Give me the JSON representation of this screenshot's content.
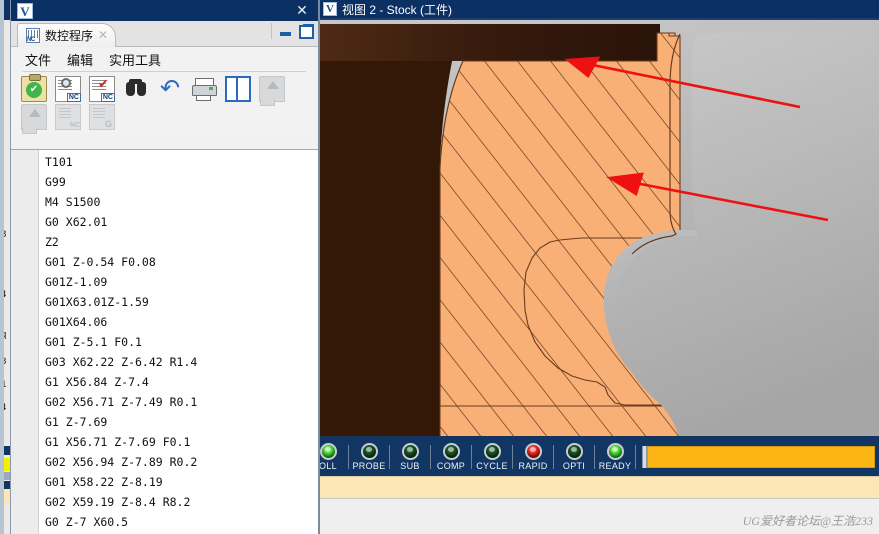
{
  "background_window": {
    "name": "hidden-background-window"
  },
  "nc_window": {
    "title_logo": "V",
    "close_label": "✕",
    "tab": {
      "label": "数控程序",
      "icon": "nc-document-icon",
      "close_label": "✕"
    },
    "window_buttons": {
      "minimize": "minimize-icon",
      "restore": "restore-icon"
    },
    "menu": [
      "文件",
      "编辑",
      "实用工具"
    ],
    "toolbar_row1": [
      {
        "name": "verify-program-icon",
        "label": "验证"
      },
      {
        "name": "nc-preview-icon",
        "label": "预览"
      },
      {
        "name": "nc-check-icon",
        "label": "检查"
      },
      {
        "name": "find-icon",
        "label": "查找"
      },
      {
        "name": "undo-icon",
        "label": "撤销"
      },
      {
        "name": "print-icon",
        "label": "打印"
      },
      {
        "name": "split-view-icon",
        "label": "分屏"
      },
      {
        "name": "upload-icon-disabled",
        "label": "上传"
      }
    ],
    "toolbar_row2": [
      {
        "name": "download-icon-disabled",
        "label": "下载"
      },
      {
        "name": "nc-file-icon-disabled",
        "label": "NC文件"
      },
      {
        "name": "g-file-icon-disabled",
        "label": "G文件"
      }
    ],
    "current_line_marker": "current-line-arrow",
    "code_lines": [
      "T101",
      "G99",
      "M4 S1500",
      "G0 X62.01",
      "Z2",
      "G01 Z-0.54 F0.08",
      "G01Z-1.09",
      "G01X63.01Z-1.59",
      "G01X64.06",
      "G01 Z-5.1 F0.1",
      "G03 X62.22 Z-6.42 R1.4",
      "G1 X56.84 Z-7.4",
      "G02 X56.71 Z-7.49 R0.1",
      "G1 Z-7.69",
      "G1 X56.71 Z-7.69 F0.1",
      "G02 X56.94 Z-7.89 R0.2",
      "G01 X58.22 Z-8.19",
      "G02 X59.19 Z-8.4 R8.2",
      "G0 Z-7 X60.5"
    ]
  },
  "view_window": {
    "title_logo": "V",
    "title": "视图 2 - Stock (工件)",
    "viewport": {
      "name": "stock-3d-viewport",
      "stock_color": "#f8b077",
      "hatch_color": "#5a2f18",
      "background_color": "#bdbdbd",
      "chuck_color": "#3b1f10",
      "annotation_arrow_color": "#ee1111",
      "annotations": 2
    },
    "status_leds": [
      {
        "label": "OLL",
        "state": "green"
      },
      {
        "label": "PROBE",
        "state": "dark"
      },
      {
        "label": "SUB",
        "state": "dark"
      },
      {
        "label": "COMP",
        "state": "dark"
      },
      {
        "label": "CYCLE",
        "state": "dark"
      },
      {
        "label": "RAPID",
        "state": "red"
      },
      {
        "label": "OPTI",
        "state": "dark"
      },
      {
        "label": "READY",
        "state": "green"
      }
    ],
    "progress_bar": {
      "name": "status-progress-bar",
      "color": "#fcb613",
      "value": 100
    },
    "message_bar": {
      "name": "message-bar",
      "text": ""
    },
    "watermark": "UG爱好者论坛@王浩233"
  }
}
